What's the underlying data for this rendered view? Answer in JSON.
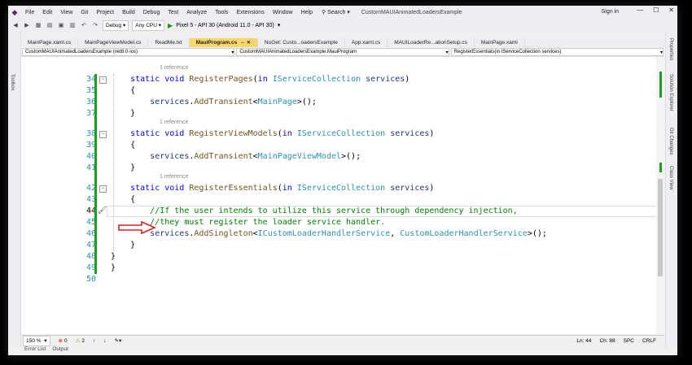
{
  "menubar": {
    "items": [
      "File",
      "Edit",
      "View",
      "Git",
      "Project",
      "Build",
      "Debug",
      "Test",
      "Analyze",
      "Tools",
      "Extensions",
      "Window",
      "Help"
    ],
    "search": "Search",
    "solution_title": "CustomMAUIAnimatedLoadersExample",
    "sign_in": "Sign in"
  },
  "toolbar": {
    "config": "Debug",
    "platform": "Any CPU",
    "run_target": "Pixel 5 - API 30 (Android 11.0 - API 30)"
  },
  "tabs": [
    {
      "label": "MainPage.xaml.cs",
      "active": false
    },
    {
      "label": "MainPageViewModel.cs",
      "active": false
    },
    {
      "label": "ReadMe.txt",
      "active": false
    },
    {
      "label": "MauiProgram.cs",
      "active": true
    },
    {
      "label": "NuGet: Custo...oadersExample",
      "active": false
    },
    {
      "label": "App.xaml.cs",
      "active": false
    },
    {
      "label": "MAUILoaderRe...ationSetup.cs",
      "active": false
    },
    {
      "label": "MainPage.xaml",
      "active": false
    }
  ],
  "navbar": {
    "project": "CustomMAUIAnimatedLoadersExample (net8.0-ios)",
    "class": "CustomMAUIAnimatedLoadersExample.MauiProgram",
    "member": "RegisterEssentials(in IServiceCollection services)"
  },
  "side_panels": {
    "left": "Toolbox",
    "right": [
      "Properties",
      "Solution Explorer",
      "Git Changes",
      "Class View"
    ]
  },
  "code": {
    "reference_label": "1 reference",
    "lines": [
      {
        "num": "34",
        "ref": true,
        "tokens": [
          [
            "",
            "    "
          ],
          [
            "k",
            "static "
          ],
          [
            "k",
            "void "
          ],
          [
            "m",
            "RegisterPages"
          ],
          [
            "",
            "("
          ],
          [
            "k",
            "in "
          ],
          [
            "t",
            "IServiceCollection "
          ],
          [
            "v",
            "services"
          ],
          [
            "",
            ")"
          ]
        ]
      },
      {
        "num": "35",
        "tokens": [
          [
            "",
            "    {"
          ]
        ]
      },
      {
        "num": "36",
        "tokens": [
          [
            "",
            "        "
          ],
          [
            "v",
            "services"
          ],
          [
            "",
            "."
          ],
          [
            "m",
            "AddTransient"
          ],
          [
            "",
            "<"
          ],
          [
            "t",
            "MainPage"
          ],
          [
            "",
            ">();"
          ]
        ]
      },
      {
        "num": "37",
        "tokens": [
          [
            "",
            "    }"
          ]
        ]
      },
      {
        "num": "38",
        "ref": true,
        "tokens": [
          [
            "",
            "    "
          ],
          [
            "k",
            "static "
          ],
          [
            "k",
            "void "
          ],
          [
            "m",
            "RegisterViewModels"
          ],
          [
            "",
            "("
          ],
          [
            "k",
            "in "
          ],
          [
            "t",
            "IServiceCollection "
          ],
          [
            "v",
            "services"
          ],
          [
            "",
            ")"
          ]
        ]
      },
      {
        "num": "39",
        "tokens": [
          [
            "",
            "    {"
          ]
        ]
      },
      {
        "num": "40",
        "tokens": [
          [
            "",
            "        "
          ],
          [
            "v",
            "services"
          ],
          [
            "",
            "."
          ],
          [
            "m",
            "AddTransient"
          ],
          [
            "",
            "<"
          ],
          [
            "t",
            "MainPageViewModel"
          ],
          [
            "",
            ">();"
          ]
        ]
      },
      {
        "num": "41",
        "tokens": [
          [
            "",
            "    }"
          ]
        ]
      },
      {
        "num": "42",
        "ref": true,
        "tokens": [
          [
            "",
            "    "
          ],
          [
            "k",
            "static "
          ],
          [
            "k",
            "void "
          ],
          [
            "m",
            "RegisterEssentials"
          ],
          [
            "",
            "("
          ],
          [
            "k",
            "in "
          ],
          [
            "t",
            "IServiceCollection "
          ],
          [
            "v",
            "services"
          ],
          [
            "",
            ")"
          ]
        ]
      },
      {
        "num": "43",
        "tokens": [
          [
            "",
            "    {"
          ]
        ]
      },
      {
        "num": "44",
        "cur": true,
        "tokens": [
          [
            "",
            "        "
          ],
          [
            "c",
            "//If the user intends to utilize this service through dependency injection,"
          ]
        ]
      },
      {
        "num": "45",
        "tokens": [
          [
            "",
            "        "
          ],
          [
            "c",
            "//they must register the loader service handler."
          ]
        ]
      },
      {
        "num": "46",
        "tokens": [
          [
            "",
            "        "
          ],
          [
            "v",
            "services"
          ],
          [
            "",
            "."
          ],
          [
            "m",
            "AddSingleton"
          ],
          [
            "",
            "<"
          ],
          [
            "t",
            "ICustomLoaderHandlerService"
          ],
          [
            "",
            ", "
          ],
          [
            "t",
            "CustomLoaderHandlerService"
          ],
          [
            "",
            ">();"
          ]
        ]
      },
      {
        "num": "47",
        "tokens": [
          [
            "",
            "    }"
          ]
        ]
      },
      {
        "num": "48",
        "tokens": [
          [
            "",
            "}"
          ]
        ]
      },
      {
        "num": "49",
        "tokens": [
          [
            "",
            "}"
          ]
        ]
      },
      {
        "num": "50",
        "tokens": [
          [
            "",
            ""
          ]
        ]
      }
    ]
  },
  "status": {
    "zoom": "150 %",
    "errors": "0",
    "warnings": "2",
    "line": "Ln: 44",
    "col": "Ch: 88",
    "spc": "SPC",
    "eol": "CRLF"
  },
  "bottom_tabs": [
    "Error List",
    "Output"
  ],
  "colors": {
    "accent_tab": "#f8d66b",
    "change_bar": "#1e9e1e",
    "arrow": "#e02020"
  }
}
